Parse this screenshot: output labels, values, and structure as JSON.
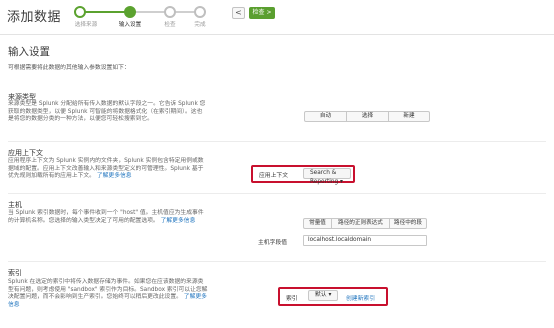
{
  "header": {
    "title": "添加数据",
    "steps": [
      {
        "label": "选择来源",
        "state": "done"
      },
      {
        "label": "输入设置",
        "state": "current"
      },
      {
        "label": "检查",
        "state": "todo"
      },
      {
        "label": "完成",
        "state": "todo"
      }
    ],
    "prev_label": "<",
    "next_label": "检查 >"
  },
  "main": {
    "title": "输入设置",
    "description": "可根据需要将此数据的其他输入参数设置如下：",
    "source_type": {
      "heading": "来源类型",
      "body": "来源类型是 Splunk 分配给所有传入数据的默认字段之一。它告诉 Splunk 您获取的数据类型，以便 Splunk 可智能的将数据格式化（在索引期间）。这也是将您的数据分类的一种方法，以便您可轻松搜索到它。",
      "options": [
        "自动",
        "选择",
        "新建"
      ]
    },
    "app_context": {
      "heading": "应用上下文",
      "body": "应用程序上下文为 Splunk 实例内的文件夹，Splunk 实例包含特定用例或数据域的配置。应用上下文改善输入和来源类型定义的可管理性。Splunk 基于优先规则加载所有的应用上下文。",
      "link": "了解更多信息",
      "label": "应用上下文",
      "value": "Search & Reporting"
    },
    "host": {
      "heading": "主机",
      "body": "当 Splunk 索引数据时，每个事件收到一个 \"host\" 值。主机值应为生成事件的计算机名称。您选择的输入类型决定了可用的配置选项。",
      "link": "了解更多信息",
      "options": [
        "常量值",
        "路径的正则表达式",
        "路径中的段"
      ],
      "field_label": "主机字段值",
      "field_value": "localhost.localdomain"
    },
    "index": {
      "heading": "索引",
      "body": "Splunk 在选定的索引中将传入数据存储为事件。如果您在应该数据的来源类型有问题，则考虑使用 \"sandbox\" 索引作为目标。Sandbox 索引可以让您解决配置问题，而不会影响到生产索引。您始终可以稍后更改此设置。",
      "link": "了解更多信息",
      "label": "索引",
      "value": "默认",
      "create_link": "创建新索引"
    }
  },
  "colors": {
    "accent_green": "#5ba22f",
    "highlight_red": "#c8102e",
    "link_blue": "#1e73be"
  }
}
